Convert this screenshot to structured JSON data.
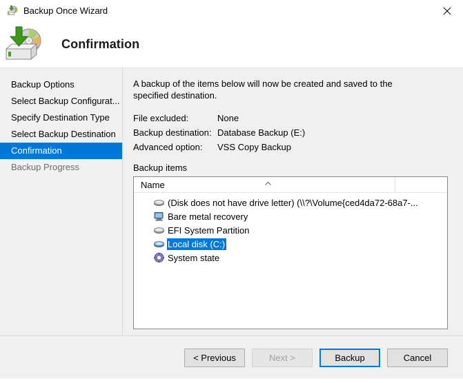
{
  "window": {
    "title": "Backup Once Wizard",
    "title_icon": "backup-disk-icon",
    "close_label": "✕"
  },
  "header": {
    "heading": "Confirmation",
    "icon": "backup-disk-arrow-icon"
  },
  "sidebar": {
    "items": [
      {
        "label": "Backup Options",
        "state": "normal"
      },
      {
        "label": "Select Backup Configurat...",
        "state": "normal"
      },
      {
        "label": "Specify Destination Type",
        "state": "normal"
      },
      {
        "label": "Select Backup Destination",
        "state": "normal"
      },
      {
        "label": "Confirmation",
        "state": "selected"
      },
      {
        "label": "Backup Progress",
        "state": "disabled"
      }
    ]
  },
  "content": {
    "intro": "A backup of the items below will now be created and saved to the specified destination.",
    "details": [
      {
        "label": "File excluded:",
        "value": "None"
      },
      {
        "label": "Backup destination:",
        "value": "Database Backup (E:)"
      },
      {
        "label": "Advanced option:",
        "value": "VSS Copy Backup"
      }
    ],
    "items_label": "Backup items",
    "list": {
      "column_header": "Name",
      "sort_indicator": "chevron-up-icon",
      "rows": [
        {
          "label": "(Disk does not have drive letter) (\\\\?\\Volume{ced4da72-68a7-...",
          "icon": "disk-icon",
          "selected": false
        },
        {
          "label": "Bare metal recovery",
          "icon": "computer-icon",
          "selected": false
        },
        {
          "label": "EFI System Partition",
          "icon": "disk-icon",
          "selected": false
        },
        {
          "label": "Local disk (C:)",
          "icon": "disk-blue-icon",
          "selected": true
        },
        {
          "label": "System state",
          "icon": "system-state-icon",
          "selected": false
        }
      ]
    }
  },
  "footer": {
    "buttons": [
      {
        "label": "< Previous",
        "state": "normal"
      },
      {
        "label": "Next >",
        "state": "disabled"
      },
      {
        "label": "Backup",
        "state": "default"
      },
      {
        "label": "Cancel",
        "state": "normal"
      }
    ]
  },
  "colors": {
    "accent": "#0078d7",
    "window_bg": "#f0f0f0",
    "list_bg": "#ffffff",
    "disabled_text": "#6d6d6d"
  }
}
